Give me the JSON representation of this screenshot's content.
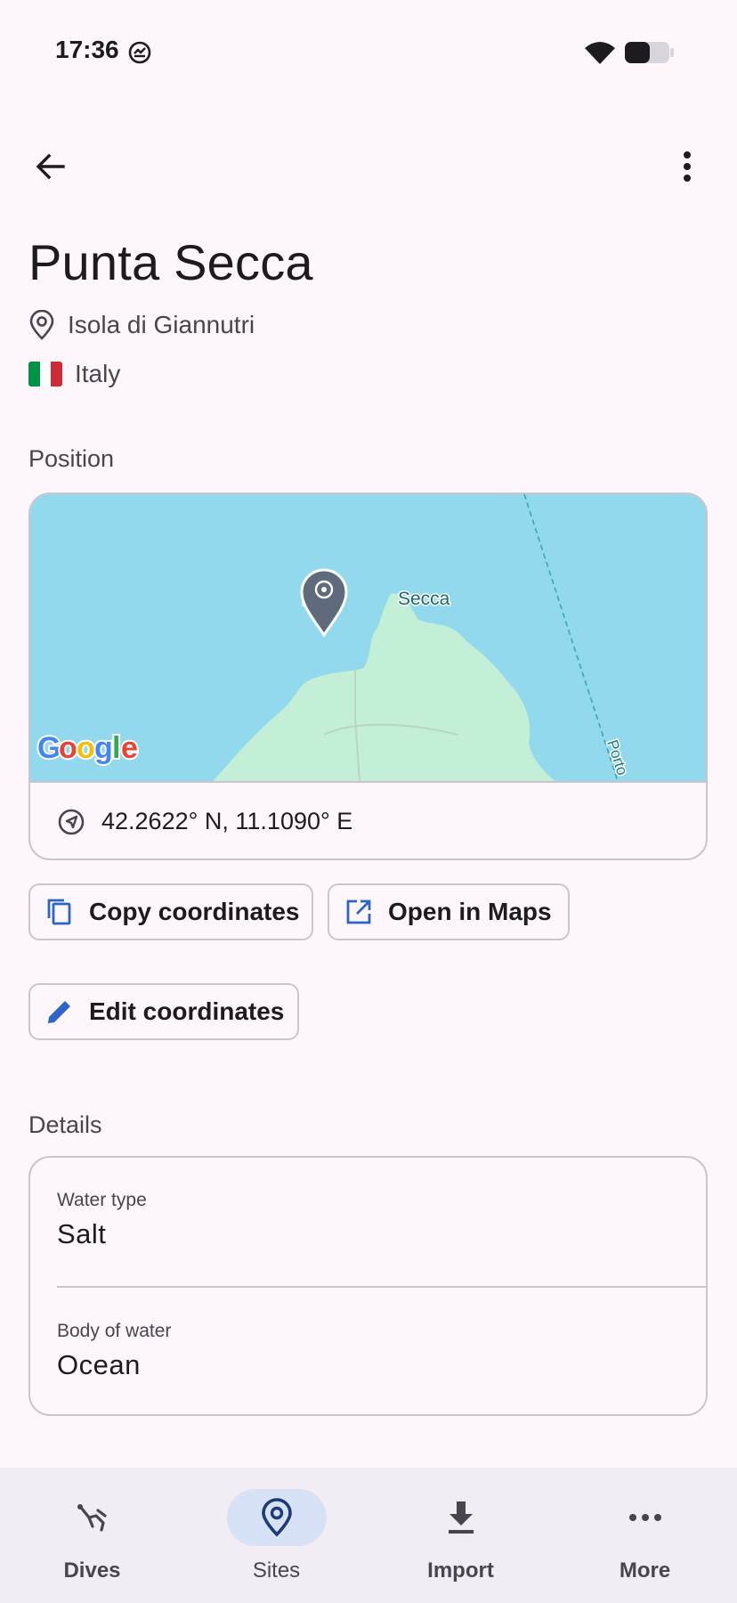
{
  "status": {
    "time": "17:36"
  },
  "site": {
    "name": "Punta Secca",
    "location": "Isola di Giannutri",
    "country": "Italy",
    "flag_colors": [
      "#009246",
      "#ffffff",
      "#ce2b37"
    ]
  },
  "position": {
    "section_label": "Position",
    "map_labels": {
      "place": "Punta Secca",
      "place_visible": "Secca",
      "route": "Porto",
      "brand": "Google"
    },
    "coordinates": "42.2622° N, 11.1090° E"
  },
  "actions": {
    "copy_label": "Copy coordinates",
    "open_maps_label": "Open in Maps",
    "edit_label": "Edit coordinates"
  },
  "details": {
    "section_label": "Details",
    "items": [
      {
        "label": "Water type",
        "value": "Salt"
      },
      {
        "label": "Body of water",
        "value": "Ocean"
      }
    ]
  },
  "nav": {
    "items": [
      {
        "label": "Dives",
        "icon": "diver-icon",
        "active": false
      },
      {
        "label": "Sites",
        "icon": "location-pin-icon",
        "active": true
      },
      {
        "label": "Import",
        "icon": "download-icon",
        "active": false
      },
      {
        "label": "More",
        "icon": "more-horizontal-icon",
        "active": false
      }
    ]
  },
  "colors": {
    "background": "#fdf7fc",
    "water": "#92d9ee",
    "land": "#c2efd5",
    "accent": "#2c64c8",
    "nav_active": "#d8e2f7"
  }
}
